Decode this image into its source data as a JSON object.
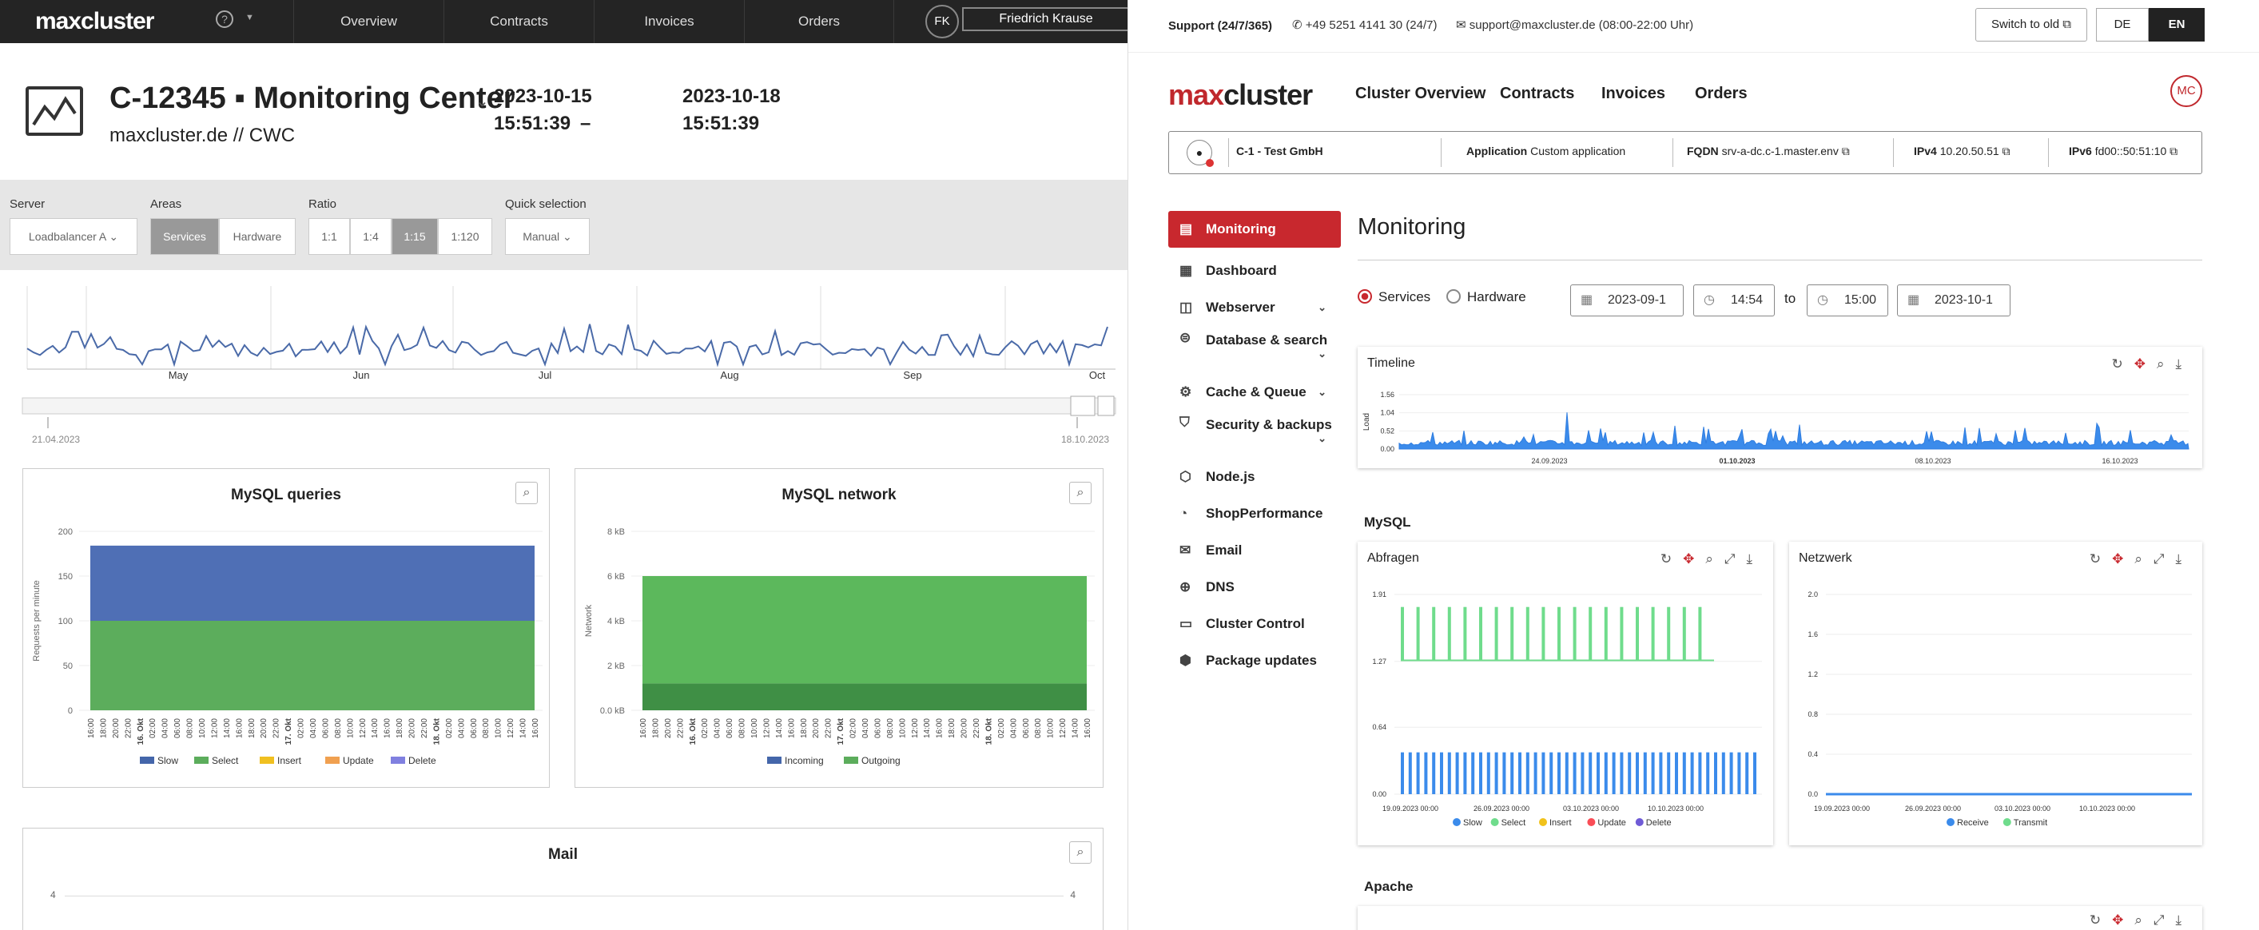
{
  "old": {
    "logo": "maxcluster",
    "help": "?",
    "nav": [
      "Overview",
      "Contracts",
      "Invoices",
      "Orders"
    ],
    "user_initials": "FK",
    "user_name": "Friedrich Krause",
    "title": "C-12345 ▪ Monitoring Center",
    "subtitle": "maxcluster.de // CWC",
    "date_from": "2023-10-15",
    "time_from": "15:51:39",
    "dash": "–",
    "date_to": "2023-10-18",
    "time_to": "15:51:39",
    "filters": {
      "server_label": "Server",
      "server_value": "Loadbalancer A",
      "areas_label": "Areas",
      "areas": [
        "Services",
        "Hardware"
      ],
      "areas_active": "Services",
      "ratio_label": "Ratio",
      "ratios": [
        "1:1",
        "1:4",
        "1:15",
        "1:120"
      ],
      "ratio_active": "1:15",
      "quick_label": "Quick selection",
      "quick_value": "Manual"
    },
    "overview_months": [
      "May",
      "Jun",
      "Jul",
      "Aug",
      "Sep",
      "Oct"
    ],
    "range_start": "21.04.2023",
    "range_end": "18.10.2023",
    "mysql_queries": {
      "title": "MySQL queries",
      "ylabel": "Requests per minute",
      "yticks": [
        "0",
        "50",
        "100",
        "150",
        "200"
      ],
      "legend": [
        "Slow",
        "Select",
        "Insert",
        "Update",
        "Delete"
      ],
      "colors": [
        "#4466aa",
        "#5cad5c",
        "#f0c020",
        "#f0a050",
        "#8080e0"
      ]
    },
    "mysql_network": {
      "title": "MySQL network",
      "ylabel": "Network",
      "yticks": [
        "0.0 kB",
        "2 kB",
        "4 kB",
        "6 kB",
        "8 kB"
      ],
      "legend": [
        "Incoming",
        "Outgoing"
      ],
      "colors": [
        "#4466aa",
        "#5cad5c"
      ]
    },
    "x_labels": [
      "16:00",
      "18:00",
      "20:00",
      "22:00",
      "16. Okt",
      "02:00",
      "04:00",
      "06:00",
      "08:00",
      "10:00",
      "12:00",
      "14:00",
      "16:00",
      "18:00",
      "20:00",
      "22:00",
      "17. Okt",
      "02:00",
      "04:00",
      "06:00",
      "08:00",
      "10:00",
      "12:00",
      "14:00",
      "16:00",
      "18:00",
      "20:00",
      "22:00",
      "18. Okt",
      "02:00",
      "04:00",
      "06:00",
      "08:00",
      "10:00",
      "12:00",
      "14:00",
      "16:00"
    ],
    "mail": {
      "title": "Mail",
      "ytick": "4"
    }
  },
  "new": {
    "support_label": "Support (24/7/365)",
    "phone": "+49 5251 4141 30 (24/7)",
    "email": "support@maxcluster.de (08:00-22:00 Uhr)",
    "switch_old": "Switch to old",
    "lang_de": "DE",
    "lang_en": "EN",
    "logo_a": "max",
    "logo_b": "cluster",
    "nav": [
      "Cluster Overview",
      "Contracts",
      "Invoices",
      "Orders"
    ],
    "avatar": "MC",
    "cluster": "C-1 - Test GmbH",
    "app_label": "Application",
    "app_value": "Custom application",
    "fqdn_label": "FQDN",
    "fqdn_value": "srv-a-dc.c-1.master.env",
    "ipv4_label": "IPv4",
    "ipv4_value": "10.20.50.51",
    "ipv6_label": "IPv6",
    "ipv6_value": "fd00::50:51:10",
    "sidebar": [
      {
        "label": "Monitoring",
        "icon": "▤"
      },
      {
        "label": "Dashboard",
        "icon": "▦"
      },
      {
        "label": "Webserver",
        "icon": "◫"
      },
      {
        "label": "Database & search",
        "icon": "⊜"
      },
      {
        "label": "Cache & Queue",
        "icon": "⚙"
      },
      {
        "label": "Security & backups",
        "icon": "⛉"
      },
      {
        "label": "Node.js",
        "icon": "⬡"
      },
      {
        "label": "ShopPerformance",
        "icon": "◔"
      },
      {
        "label": "Email",
        "icon": "✉"
      },
      {
        "label": "DNS",
        "icon": "⊕"
      },
      {
        "label": "Cluster Control",
        "icon": "▭"
      },
      {
        "label": "Package updates",
        "icon": "⬢"
      }
    ],
    "page_title": "Monitoring",
    "radio_services": "Services",
    "radio_hardware": "Hardware",
    "date_from": "2023-09-1",
    "time_from": "14:54",
    "to": "to",
    "time_to": "15:00",
    "date_to": "2023-10-1",
    "timeline": {
      "title": "Timeline",
      "ylabel": "Load",
      "yticks": [
        "0.00",
        "0.52",
        "1.04",
        "1.56"
      ],
      "xticks": [
        "24.09.2023",
        "01.10.2023",
        "08.10.2023",
        "16.10.2023"
      ]
    },
    "mysql_section": "MySQL",
    "abfragen": {
      "title": "Abfragen",
      "yticks": [
        "0.00",
        "0.64",
        "1.27",
        "1.91"
      ],
      "xticks": [
        "19.09.2023 00:00",
        "26.09.2023 00:00",
        "03.10.2023 00:00",
        "10.10.2023 00:00"
      ],
      "legend": [
        "Slow",
        "Select",
        "Insert",
        "Update",
        "Delete"
      ],
      "colors": [
        "#3b8beb",
        "#6fdc8c",
        "#f1c21b",
        "#fa4d56",
        "#6f5bd6"
      ]
    },
    "netzwerk": {
      "title": "Netzwerk",
      "yticks": [
        "0.0",
        "0.4",
        "0.8",
        "1.2",
        "1.6",
        "2.0"
      ],
      "xticks": [
        "19.09.2023 00:00",
        "26.09.2023 00:00",
        "03.10.2023 00:00",
        "10.10.2023 00:00"
      ],
      "legend": [
        "Receive",
        "Transmit"
      ],
      "colors": [
        "#3b8beb",
        "#6fdc8c"
      ]
    },
    "apache_section": "Apache"
  }
}
